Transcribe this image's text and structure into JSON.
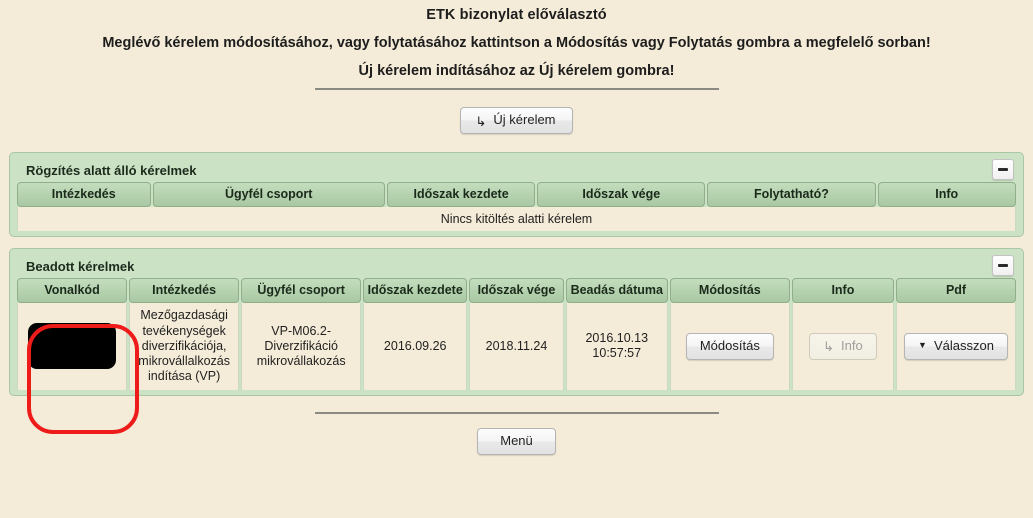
{
  "header": {
    "title": "ETK bizonylat előválasztó",
    "instruction_1": "Meglévő kérelem módosításához, vagy folytatásához kattintson a Módosítás vagy Folytatás gombra a megfelelő sorban!",
    "instruction_2": "Új kérelem indításához az Új kérelem gombra!"
  },
  "new_request_button": {
    "label": "Új kérelem",
    "icon": "arrow-enter-icon",
    "icon_glyph": "↳"
  },
  "panels": [
    {
      "title": "Rögzítés alatt álló kérelmek",
      "collapse_icon": "minimize-icon",
      "columns": [
        "Intézkedés",
        "Ügyfél csoport",
        "Időszak kezdete",
        "Időszak vége",
        "Folytatható?",
        "Info"
      ],
      "empty_message": "Nincs kitöltés alatti kérelem",
      "rows": []
    },
    {
      "title": "Beadott kérelmek",
      "collapse_icon": "minimize-icon",
      "columns": [
        "Vonalkód",
        "Intézkedés",
        "Ügyfél csoport",
        "Időszak kezdete",
        "Időszak vége",
        "Beadás dátuma",
        "Módosítás",
        "Info",
        "Pdf"
      ],
      "rows": [
        {
          "vonalkod": "",
          "vonalkod_redacted": true,
          "intezkedes": "Mezőgazdasági tevékenységek diverzifikációja, mikrovállalkozás indítása (VP)",
          "ugyfel_csoport": "VP-M06.2-Diverzifikáció mikrovállakozás",
          "idoszak_kezdete": "2016.09.26",
          "idoszak_vege": "2018.11.24",
          "beadas_datuma": "2016.10.13 10:57:57",
          "modositas_button": "Módosítás",
          "info_button": "Info",
          "info_button_icon": "arrow-enter-icon",
          "info_button_icon_glyph": "↳",
          "info_button_disabled": true,
          "pdf_button": "Válasszon",
          "pdf_button_icon": "chevron-down-icon",
          "pdf_button_icon_glyph": "▼"
        }
      ]
    }
  ],
  "footer": {
    "menu_label": "Menü"
  },
  "annotation": {
    "type": "highlight-circle",
    "color": "#ee1b1b",
    "target": "Vonalkód"
  },
  "colors": {
    "page_background": "#f4ecd8",
    "panel_background": "#cbe2c5",
    "header_cell": "#a8c8a2",
    "annotation_red": "#ee1b1b"
  }
}
